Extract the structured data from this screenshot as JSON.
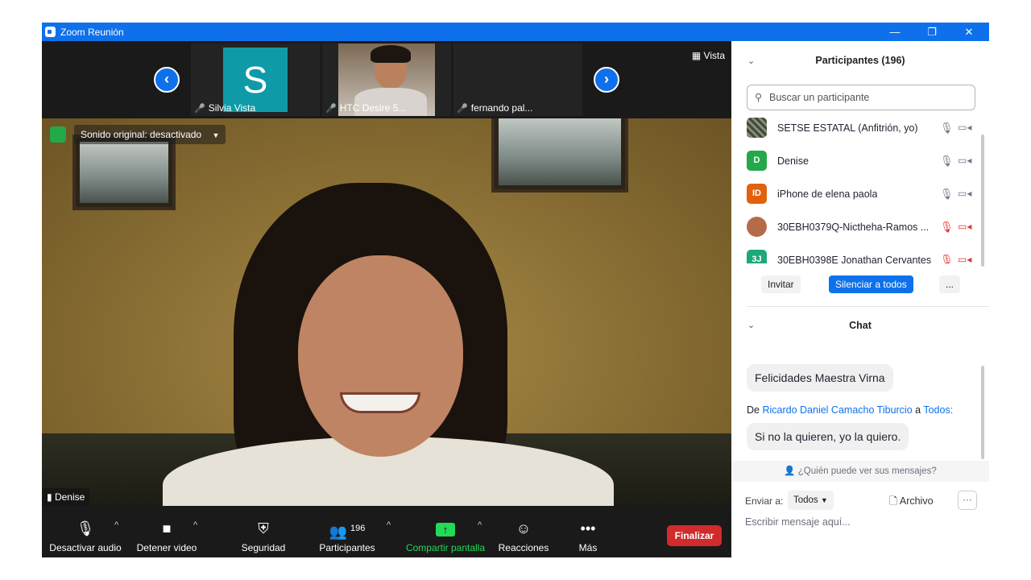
{
  "window": {
    "title": "Zoom Reunión",
    "minimize": "—",
    "restore": "❐",
    "close": "✕"
  },
  "strip": {
    "prev": "‹",
    "next": "›",
    "view_label": "Vista",
    "thumbs": [
      {
        "initial": "S",
        "name": "Silvia Vista"
      },
      {
        "name": "HTC Desire 5..."
      },
      {
        "name": "fernando pal..."
      }
    ]
  },
  "main": {
    "audio_status": "Sonido original: desactivado",
    "speaker": "Denise"
  },
  "toolbar": {
    "audio": "Desactivar audio",
    "video": "Detener video",
    "security": "Seguridad",
    "participants": "Participantes",
    "participants_count": "196",
    "share": "Compartir pantalla",
    "reactions": "Reacciones",
    "more": "Más",
    "end": "Finalizar"
  },
  "participants_panel": {
    "title": "Participantes (196)",
    "search_placeholder": "Buscar un participante",
    "items": [
      {
        "name": "SETSE ESTATAL (Anfitrión, yo)",
        "avatar": "",
        "color": "#4a4f46",
        "muted": false
      },
      {
        "name": "Denise",
        "avatar": "D",
        "color": "#23a94a",
        "muted": false
      },
      {
        "name": "iPhone de elena paola",
        "avatar": "ID",
        "color": "#e0620d",
        "muted": false
      },
      {
        "name": "30EBH0379Q-Nictheha-Ramos ...",
        "avatar": "",
        "color": "#b56a4a",
        "muted": true
      },
      {
        "name": "30EBH0398E Jonathan Cervantes",
        "avatar": "3J",
        "color": "#1ea77c",
        "muted": true
      }
    ],
    "invite": "Invitar",
    "mute_all": "Silenciar a todos",
    "more": "..."
  },
  "chat": {
    "title": "Chat",
    "message1": "Felicidades Maestra Virna",
    "from_prefix": "De",
    "from_sender": "Ricardo Daniel Camacho Tiburcio",
    "from_mid": "a",
    "from_target": "Todos:",
    "message2": "Si no la quieren, yo la quiero.",
    "who_can_see": "¿Quién puede ver sus mensajes?",
    "send_to_label": "Enviar a:",
    "recipient": "Todos",
    "file": "Archivo",
    "more": "···",
    "input_placeholder": "Escribir mensaje aquí..."
  },
  "colors": {
    "zoom_blue": "#0e71eb",
    "end_red": "#d12b2b",
    "share_green": "#23d959",
    "muted_red": "#e0332f"
  }
}
